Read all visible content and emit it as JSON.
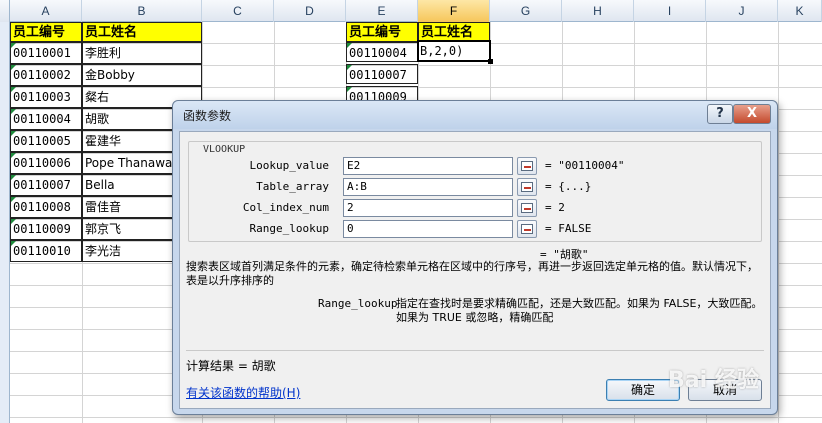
{
  "sheet": {
    "columns": [
      "A",
      "B",
      "C",
      "D",
      "E",
      "F",
      "G",
      "H",
      "I",
      "J",
      "K"
    ],
    "selected_column": "F",
    "table1": {
      "header": [
        "员工编号",
        "员工姓名"
      ],
      "rows": [
        [
          "00110001",
          "李胜利"
        ],
        [
          "00110002",
          "金Bobby"
        ],
        [
          "00110003",
          "粲右"
        ],
        [
          "00110004",
          "胡歌"
        ],
        [
          "00110005",
          "霍建华"
        ],
        [
          "00110006",
          "Pope Thanawat"
        ],
        [
          "00110007",
          "Bella"
        ],
        [
          "00110008",
          "雷佳音"
        ],
        [
          "00110009",
          "郭京飞"
        ],
        [
          "00110010",
          "李光洁"
        ]
      ]
    },
    "table2": {
      "header": [
        "员工编号",
        "员工姓名"
      ],
      "ids": [
        "00110004",
        "00110007",
        "00110009"
      ]
    },
    "active_cell_formula": "B,2,0)"
  },
  "dialog": {
    "title": "函数参数",
    "help_button": "?",
    "close_button": "X",
    "function_name": "VLOOKUP",
    "args": [
      {
        "label": "Lookup_value",
        "value": "E2",
        "eval": "= \"00110004\""
      },
      {
        "label": "Table_array",
        "value": "A:B",
        "eval": "= {...}"
      },
      {
        "label": "Col_index_num",
        "value": "2",
        "eval": "= 2"
      },
      {
        "label": "Range_lookup",
        "value": "0",
        "eval": "= FALSE"
      }
    ],
    "result_preview": "= \"胡歌\"",
    "description": "搜索表区域首列满足条件的元素，确定待检索单元格在区域中的行序号，再进一步返回选定单元格的值。默认情况下，表是以升序排序的",
    "arg_help_name": "Range_lookup",
    "arg_help_text": "指定在查找时是要求精确匹配，还是大致匹配。如果为 FALSE，大致匹配。如果为 TRUE 或忽略，精确匹配",
    "calc_result": "计算结果 =  胡歌",
    "help_link": "有关该函数的帮助(H)",
    "ok_button": "确定",
    "cancel_button": "取消"
  },
  "watermark": "Bai 经验"
}
